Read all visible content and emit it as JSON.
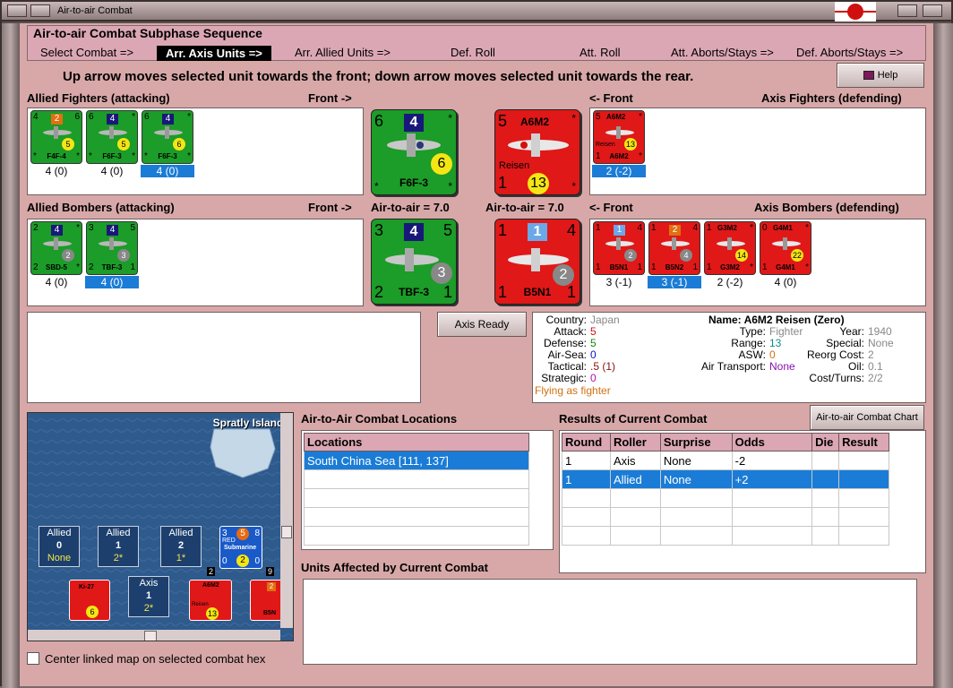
{
  "window": {
    "title": "Air-to-air Combat"
  },
  "phase": {
    "header": "Air-to-air Combat Subphase Sequence",
    "steps": [
      "Select Combat =>",
      "Arr. Axis Units =>",
      "Arr. Allied Units =>",
      "Def. Roll",
      "Att. Roll",
      "Att. Aborts/Stays =>",
      "Def. Aborts/Stays =>"
    ]
  },
  "instruction": "Up arrow moves selected unit towards the front; down arrow moves selected unit towards the rear.",
  "help_label": "Help",
  "labels": {
    "allied_fighters": "Allied Fighters (attacking)",
    "front_right": "Front ->",
    "front_left": "<- Front",
    "axis_fighters": "Axis Fighters (defending)",
    "allied_bombers": "Allied Bombers (attacking)",
    "air_to_air_allied": "Air-to-air = 7.0",
    "air_to_air_axis": "Air-to-air = 7.0",
    "axis_bombers": "Axis Bombers (defending)"
  },
  "allied_fighters": [
    {
      "name": "F4F-4",
      "tl": "4",
      "tr": "6",
      "bl": "*",
      "br": "*",
      "sq": "2",
      "sqcolor": "#e07010",
      "dot": "5",
      "stat": "4 (0)"
    },
    {
      "name": "F6F-3",
      "tl": "6",
      "tr": "*",
      "bl": "*",
      "br": "*",
      "sq": "4",
      "sqcolor": "#18187a",
      "dot": "5",
      "stat": "4 (0)"
    },
    {
      "name": "F6F-3",
      "tl": "6",
      "tr": "*",
      "bl": "*",
      "br": "*",
      "sq": "4",
      "sqcolor": "#18187a",
      "dot": "6",
      "stat": "4 (0)"
    }
  ],
  "axis_fighters": [
    {
      "name": "A6M2",
      "sub": "Reisen",
      "tl": "5",
      "tr": "*",
      "bl": "1",
      "br": "*",
      "dot": "13",
      "stat": "2 (-2)"
    }
  ],
  "allied_bombers": [
    {
      "name": "SBD-5",
      "tl": "2",
      "tr": "*",
      "bl": "2",
      "br": "*",
      "sq": "4",
      "sqcolor": "#18187a",
      "dot": "2",
      "stat": "4 (0)"
    },
    {
      "name": "TBF-3",
      "tl": "3",
      "tr": "5",
      "bl": "2",
      "br": "1",
      "sq": "4",
      "sqcolor": "#18187a",
      "dot": "3",
      "stat": "4 (0)"
    }
  ],
  "axis_bombers": [
    {
      "name": "B5N1",
      "tl": "1",
      "tr": "4",
      "bl": "1",
      "br": "1",
      "sq": "1",
      "sqcolor": "#6aa8e8",
      "dot": "2",
      "stat": "3 (-1)"
    },
    {
      "name": "B5N2",
      "tl": "1",
      "tr": "4",
      "bl": "1",
      "br": "1",
      "sq": "2",
      "sqcolor": "#e07010",
      "dot": "4",
      "stat": "3 (-1)"
    },
    {
      "name": "G3M2",
      "tl": "1",
      "tr": "*",
      "bl": "1",
      "br": "*",
      "dot": "14",
      "stat": "2 (-2)"
    },
    {
      "name": "G4M1",
      "tl": "0",
      "tr": "*",
      "bl": "1",
      "br": "*",
      "dot": "22",
      "stat": "4 (0)"
    }
  ],
  "big_allied_fighter": {
    "name": "F6F-3",
    "tl": "6",
    "tr": "*",
    "bl": "*",
    "br": "*",
    "sq": "4",
    "dot": "6"
  },
  "big_axis_fighter": {
    "name": "A6M2",
    "sub": "Reisen",
    "tl": "5",
    "tr": "*",
    "bl": "1",
    "br": "*",
    "dot": "13"
  },
  "big_allied_bomber": {
    "name": "TBF-3",
    "tl": "3",
    "tr": "5",
    "bl": "2",
    "br": "1",
    "sq": "4",
    "dot": "3"
  },
  "big_axis_bomber": {
    "name": "B5N1",
    "tl": "1",
    "tr": "4",
    "bl": "1",
    "br": "1",
    "sq": "1",
    "dot": "2"
  },
  "axis_ready_label": "Axis Ready",
  "info": {
    "country_k": "Country:",
    "country": "Japan",
    "attack_k": "Attack:",
    "attack": "5",
    "defense_k": "Defense:",
    "defense": "5",
    "airsea_k": "Air-Sea:",
    "airsea": "0",
    "tactical_k": "Tactical:",
    "tactical": ".5 (1)",
    "strategic_k": "Strategic:",
    "strategic": "0",
    "flying": "Flying as fighter",
    "name": "Name: A6M2 Reisen (Zero)",
    "type_k": "Type:",
    "type": "Fighter",
    "range_k": "Range:",
    "range": "13",
    "asw_k": "ASW:",
    "asw": "0",
    "transport_k": "Air Transport:",
    "transport": "None",
    "year_k": "Year:",
    "year": "1940",
    "special_k": "Special:",
    "special": "None",
    "reorg_k": "Reorg Cost:",
    "reorg": "2",
    "oil_k": "Oil:",
    "oil": "0.1",
    "cost_k": "Cost/Turns:",
    "cost": "2/2"
  },
  "map": {
    "label": "Spratly Islands",
    "boxes": [
      {
        "t": "Allied",
        "n": "0",
        "y": "None"
      },
      {
        "t": "Allied",
        "n": "1",
        "y": "2*"
      },
      {
        "t": "Allied",
        "n": "2",
        "y": "1*"
      },
      {
        "t": "Axis",
        "n": "1",
        "y": "2*"
      }
    ],
    "sub": {
      "label": "Submarine",
      "tag": "RED",
      "tl": "3",
      "n": "5",
      "tr": "8",
      "bl": "0",
      "dot": "2",
      "br": "0"
    },
    "units": [
      {
        "name": "Ki-27",
        "dot": "6"
      },
      {
        "name": "A6M2",
        "sub": "Reisen",
        "dot": "13",
        "badge": "2"
      },
      {
        "name": "B5N",
        "badge": "9",
        "sq": "2"
      }
    ]
  },
  "center_label": "Center linked map on selected combat hex",
  "locations": {
    "title": "Air-to-Air Combat Locations",
    "header": "Locations",
    "rows": [
      "South China Sea [111, 137]"
    ]
  },
  "results": {
    "title": "Results of Current Combat",
    "chart_button": "Air-to-air Combat Chart",
    "headers": [
      "Round",
      "Roller",
      "Surprise",
      "Odds",
      "Die",
      "Result"
    ],
    "rows": [
      [
        "1",
        "Axis",
        "None",
        "-2",
        "",
        ""
      ],
      [
        "1",
        "Allied",
        "None",
        "+2",
        "",
        ""
      ]
    ]
  },
  "affected": {
    "title": "Units Affected by Current Combat"
  },
  "colors": {
    "allied": "#1c9c28",
    "axis": "#e01818",
    "selection": "#1a7cd6",
    "background": "#d8a8a8"
  }
}
